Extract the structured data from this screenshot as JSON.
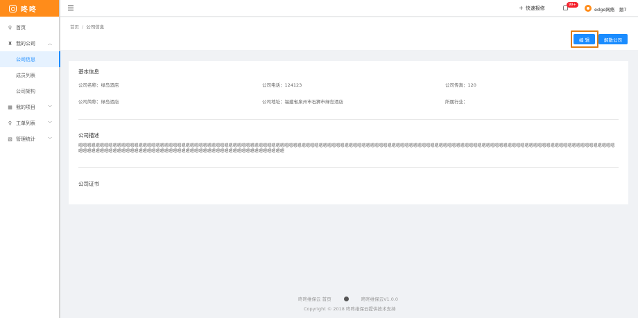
{
  "logo": {
    "text": "咚咚"
  },
  "sidebar": {
    "items": [
      {
        "label": "首页",
        "icon": "user-icon"
      },
      {
        "label": "我的公司",
        "icon": "company-icon",
        "expanded": true
      },
      {
        "label": "公司信息",
        "active": true
      },
      {
        "label": "成员列表"
      },
      {
        "label": "公司架构"
      },
      {
        "label": "我的项目",
        "icon": "project-icon"
      },
      {
        "label": "工单列表",
        "icon": "ticket-icon"
      },
      {
        "label": "管理统计",
        "icon": "stats-icon"
      }
    ]
  },
  "header": {
    "quick_report": "快速报修",
    "badge": "99+",
    "username": "edge网络",
    "username_extra": "题7"
  },
  "breadcrumb": {
    "home": "首页",
    "sep": "/",
    "current": "公司信息"
  },
  "actions": {
    "edit": "编 辑",
    "dissolve": "解散公司"
  },
  "basic_info": {
    "title": "基本信息",
    "company_name": "公司名称：绿岛酒店",
    "phone": "公司电话：124123",
    "fax": "公司传真：120",
    "short_name": "公司简称：绿岛酒店",
    "address": "公司地址：福建省泉州市石狮市绿岛酒店",
    "industry": "所属行业："
  },
  "description": {
    "title": "公司描述",
    "text": "嗯嗯嗯嗯嗯嗯嗯嗯嗯嗯嗯嗯嗯嗯嗯嗯嗯嗯嗯嗯嗯嗯嗯嗯嗯嗯嗯嗯嗯嗯嗯嗯嗯嗯嗯嗯嗯嗯嗯嗯嗯嗯嗯嗯嗯嗯嗯嗯嗯嗯嗯嗯嗯嗯嗯嗯嗯嗯嗯嗯嗯嗯嗯嗯嗯嗯嗯嗯嗯嗯嗯嗯嗯嗯嗯嗯嗯嗯嗯嗯嗯嗯嗯嗯嗯嗯嗯嗯嗯嗯嗯嗯嗯嗯嗯嗯嗯嗯嗯嗯嗯嗯嗯嗯嗯嗯嗯嗯嗯嗯嗯嗯嗯嗯嗯嗯嗯嗯嗯嗯嗯嗯嗯嗯嗯嗯嗯嗯嗯嗯嗯嗯嗯嗯嗯嗯嗯嗯嗯嗯嗯嗯嗯嗯嗯嗯嗯嗯嗯嗯嗯嗯嗯嗯嗯嗯嗯嗯嗯嗯嗯嗯嗯嗯嗯嗯嗯嗯嗯嗯嗯嗯嗯"
  },
  "certificate": {
    "title": "公司证书"
  },
  "footer": {
    "home_link": "咚咚维保云 首页",
    "version": "咚咚维保云V1.0.0",
    "copyright": "Copyright © 2018 咚咚维保云提供技术支持"
  },
  "colors": {
    "brand": "#ff8c1a",
    "primary": "#1a8cff",
    "highlight": "#e07c10"
  }
}
